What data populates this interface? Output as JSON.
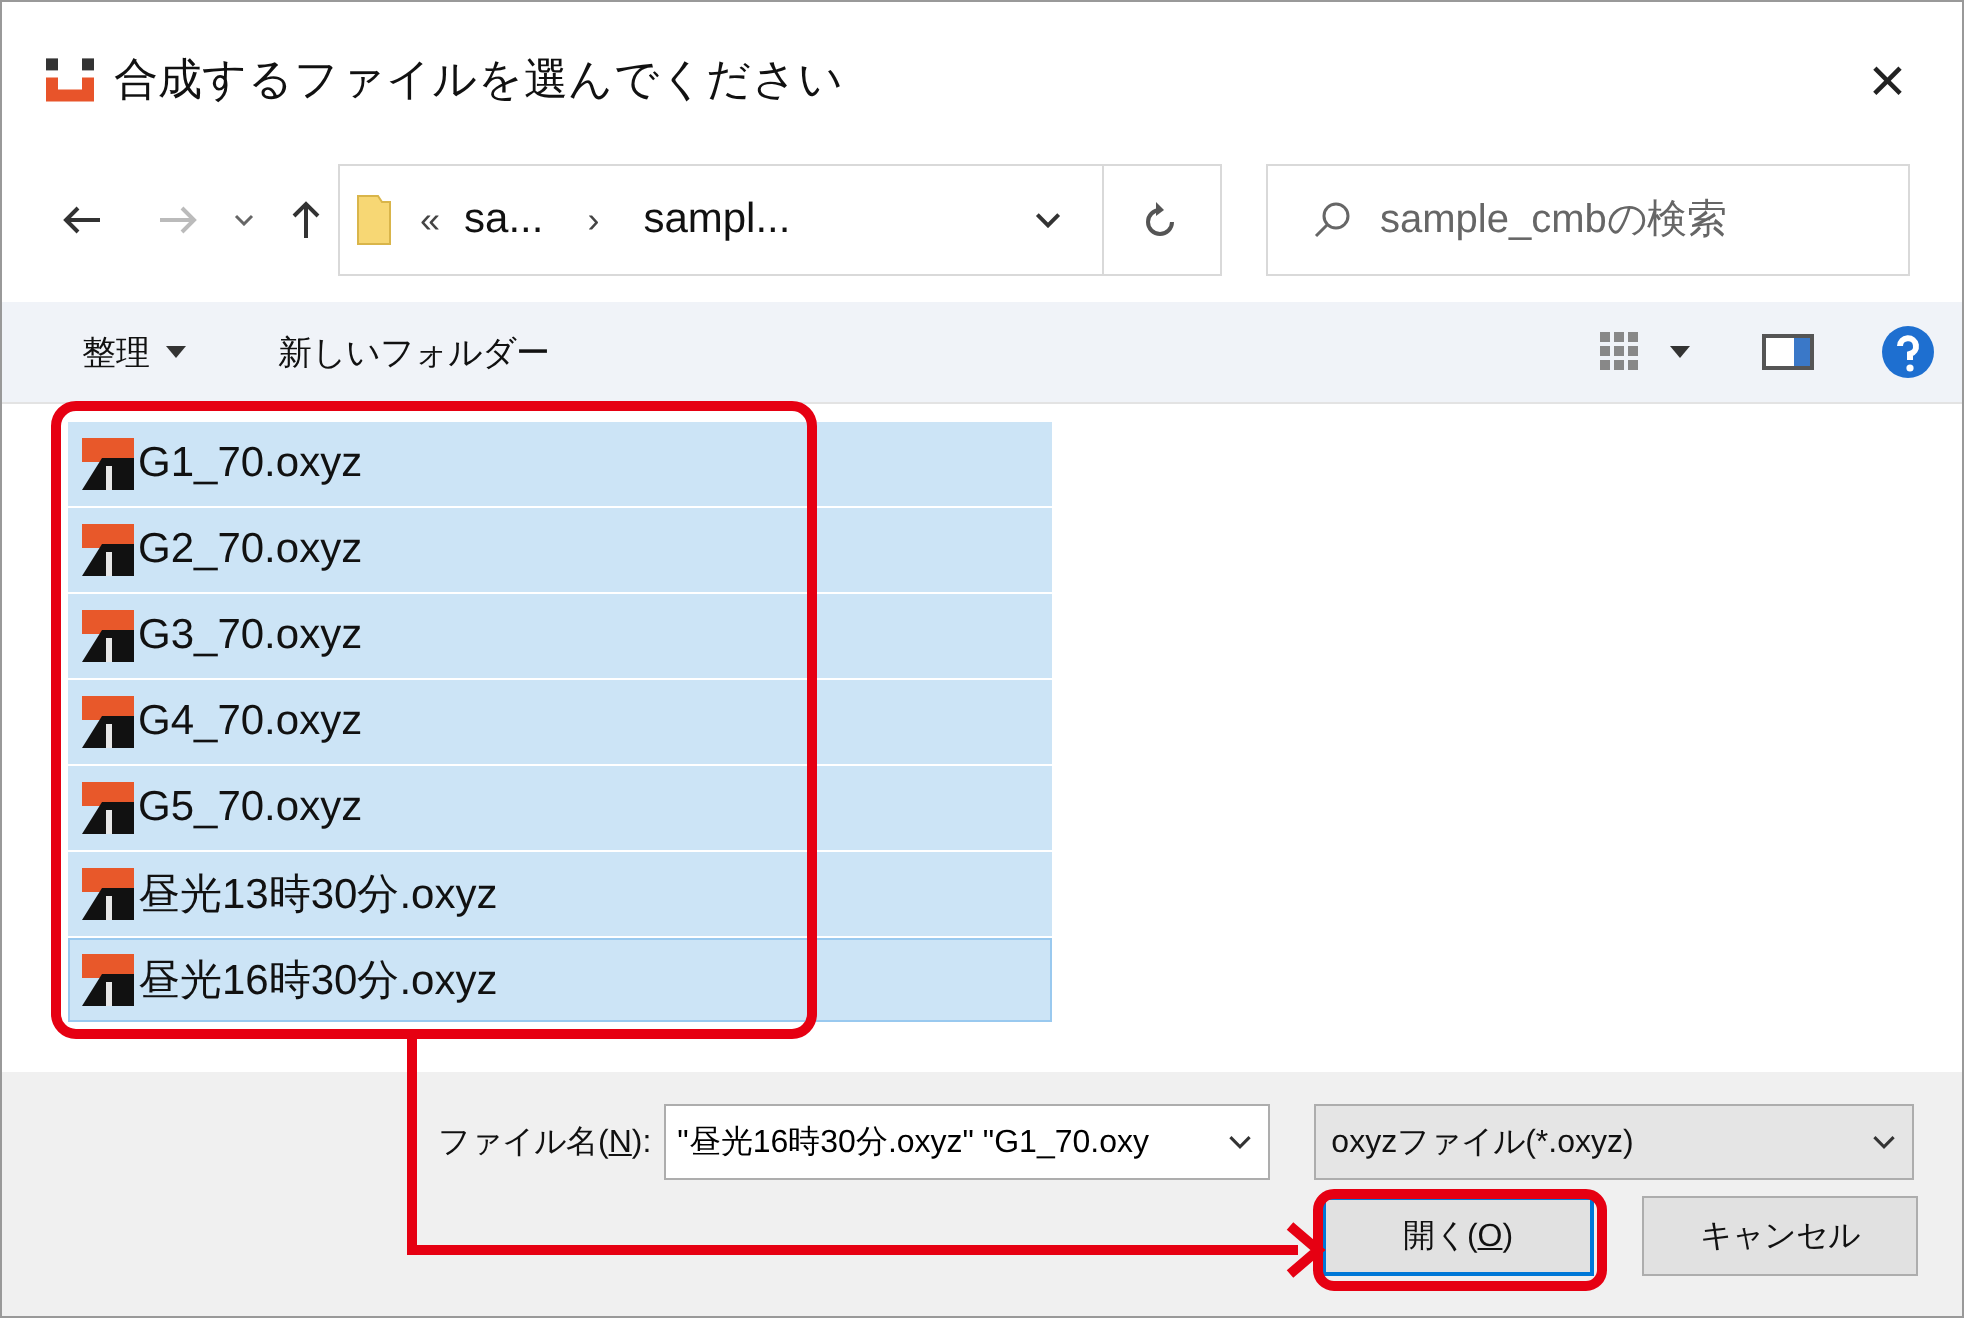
{
  "window": {
    "title": "合成するファイルを選んでください",
    "close": "×"
  },
  "navigation": {
    "overflow": "«",
    "separator": "›",
    "path": [
      {
        "label": "sa..."
      },
      {
        "label": "sampl..."
      }
    ],
    "search": {
      "placeholder": "sample_cmbの検索"
    }
  },
  "toolbar": {
    "organize": "整理",
    "new_folder": "新しいフォルダー"
  },
  "files": [
    {
      "name": "G1_70.oxyz",
      "selected": true,
      "focused": false
    },
    {
      "name": "G2_70.oxyz",
      "selected": true,
      "focused": false
    },
    {
      "name": "G3_70.oxyz",
      "selected": true,
      "focused": false
    },
    {
      "name": "G4_70.oxyz",
      "selected": true,
      "focused": false
    },
    {
      "name": "G5_70.oxyz",
      "selected": true,
      "focused": false
    },
    {
      "name": "昼光13時30分.oxyz",
      "selected": true,
      "focused": false
    },
    {
      "name": "昼光16時30分.oxyz",
      "selected": true,
      "focused": true
    }
  ],
  "file_name": {
    "label_before": "ファイル名(",
    "access_key": "N",
    "label_after": "):",
    "value": "\"昼光16時30分.oxyz\" \"G1_70.oxy"
  },
  "file_type": {
    "value": "oxyzファイル(*.oxyz)"
  },
  "buttons": [
    {
      "kind": "default",
      "label_before": "開く(",
      "access_key": "O",
      "label_after": ")"
    },
    {
      "kind": "normal",
      "label_before": "キャンセル"
    }
  ]
}
